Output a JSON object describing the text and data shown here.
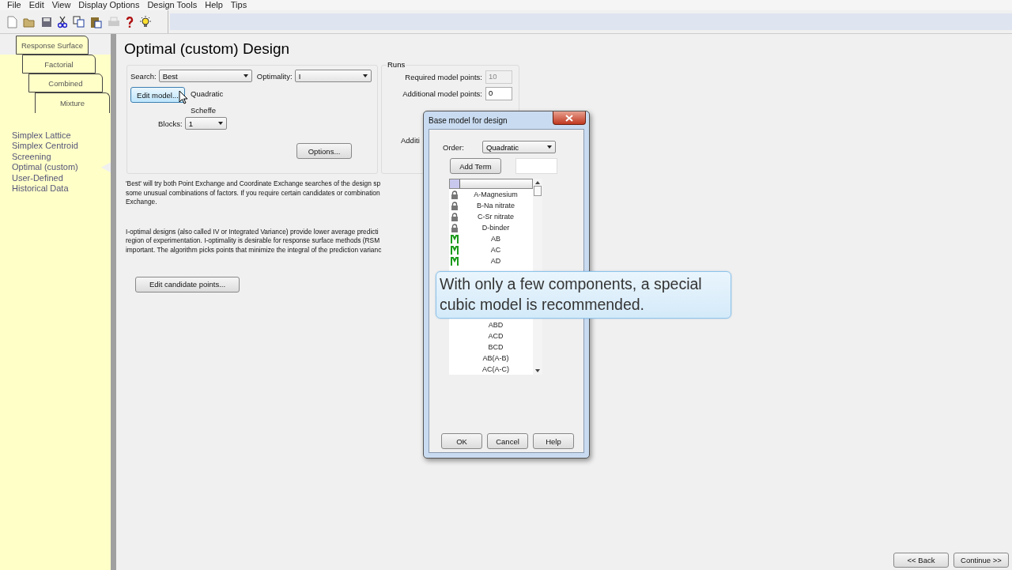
{
  "menu": [
    "File",
    "Edit",
    "View",
    "Display Options",
    "Design Tools",
    "Help",
    "Tips"
  ],
  "toolbar": [
    {
      "kind": "new",
      "disabled": false
    },
    {
      "kind": "open",
      "disabled": false
    },
    {
      "kind": "save",
      "disabled": false
    },
    {
      "kind": "cut",
      "disabled": false
    },
    {
      "kind": "copy",
      "disabled": false
    },
    {
      "kind": "paste",
      "disabled": false
    },
    {
      "kind": "print",
      "disabled": true
    },
    {
      "kind": "help",
      "disabled": false
    },
    {
      "kind": "tip",
      "disabled": false
    }
  ],
  "design_tabs": [
    {
      "label": "Response Surface",
      "selected": false
    },
    {
      "label": "Factorial",
      "selected": false
    },
    {
      "label": "Combined",
      "selected": false
    },
    {
      "label": "Mixture",
      "selected": true
    }
  ],
  "design_types": [
    {
      "label": "Simplex Lattice",
      "selected": false
    },
    {
      "label": "Simplex Centroid",
      "selected": false
    },
    {
      "label": "Screening",
      "selected": false
    },
    {
      "label": "Optimal (custom)",
      "selected": true
    },
    {
      "label": "User-Defined",
      "selected": false
    },
    {
      "label": "Historical Data",
      "selected": false
    }
  ],
  "page_title": "Optimal (custom) Design",
  "search": {
    "label": "Search:",
    "value": "Best"
  },
  "optimality": {
    "label": "Optimality:",
    "value": "I"
  },
  "edit_model_button": "Edit model...",
  "model_order": "Quadratic",
  "model_type": "Scheffe",
  "blocks": {
    "label": "Blocks:",
    "value": "1"
  },
  "options_button": "Options...",
  "runs": {
    "title": "Runs",
    "fields": [
      {
        "label": "Required model points:",
        "value": "10",
        "disabled": true
      },
      {
        "label": "Additional model points:",
        "value": "0",
        "disabled": false
      }
    ],
    "cut_label": "Additi"
  },
  "description": [
    [
      "'Best' will try both Point Exchange and Coordinate Exchange searches of the design sp",
      "some unusual combinations of factors. If you require certain candidates or combination",
      "Exchange."
    ],
    [
      "I-optimal designs (also called IV or Integrated Variance) provide lower average predicti",
      "region of experimentation.  I-optimality is desirable for response surface methods (RSM",
      "important.  The algorithm picks points that minimize the integral of the prediction varianc"
    ]
  ],
  "candidate_button": "Edit candidate points...",
  "nav_buttons": [
    "<< Back",
    "Continue >>"
  ],
  "dialog": {
    "title": "Base model for design",
    "order": {
      "label": "Order:",
      "value": "Quadratic"
    },
    "add_term_button": "Add Term",
    "terms_above": [
      {
        "label": "A-Magnesium",
        "kind": "lock"
      },
      {
        "label": "B-Na nitrate",
        "kind": "lock"
      },
      {
        "label": "C-Sr nitrate",
        "kind": "lock"
      },
      {
        "label": "D-binder",
        "kind": "lock"
      },
      {
        "label": "AB",
        "kind": "model"
      },
      {
        "label": "AC",
        "kind": "model"
      },
      {
        "label": "AD",
        "kind": "model"
      }
    ],
    "terms_below": [
      {
        "label": "ABD"
      },
      {
        "label": "ACD"
      },
      {
        "label": "BCD"
      },
      {
        "label": "AB(A-B)"
      },
      {
        "label": "AC(A-C)"
      }
    ],
    "buttons": [
      "OK",
      "Cancel",
      "Help"
    ]
  },
  "tooltip": "With only a few components, a special cubic model is recommended."
}
